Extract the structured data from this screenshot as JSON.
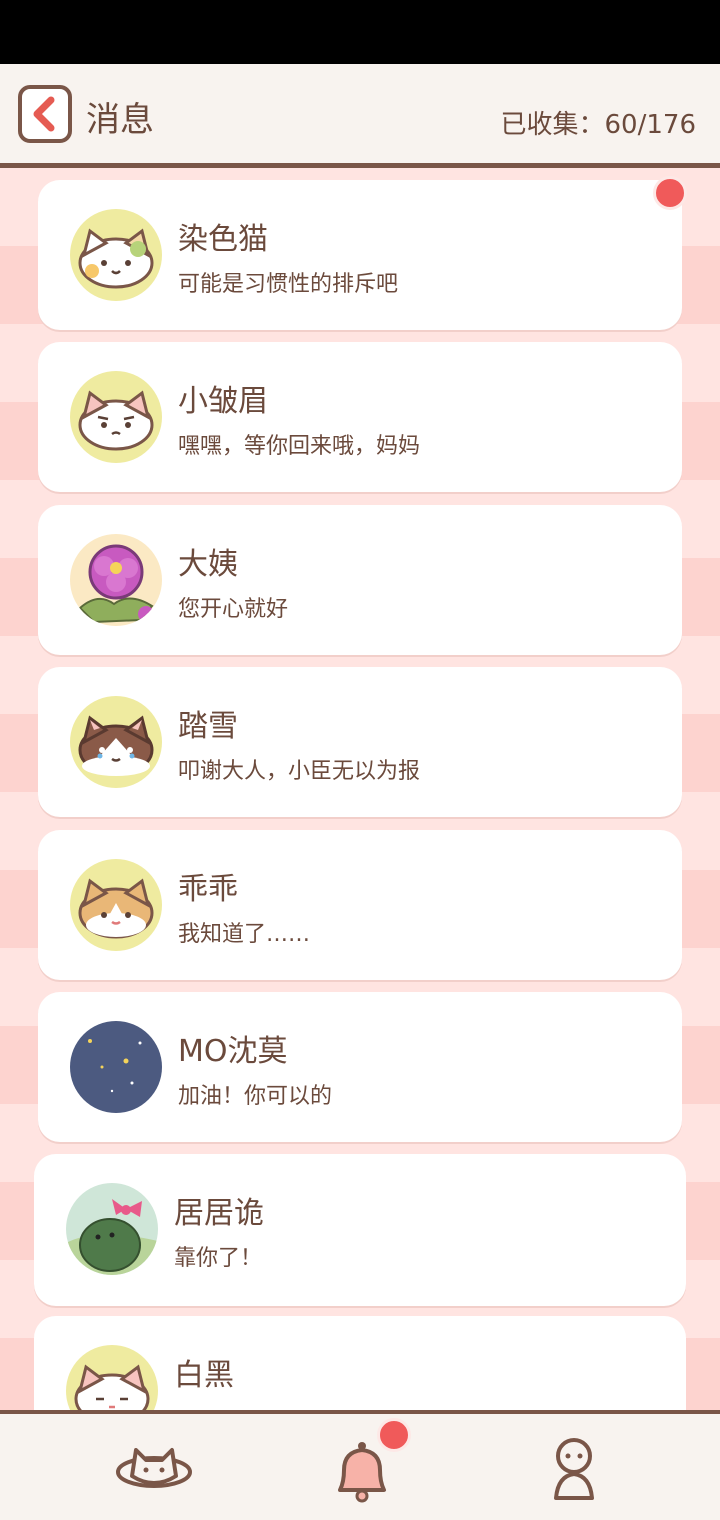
{
  "header": {
    "title": "消息",
    "collected_label": "已收集：60/176"
  },
  "messages": [
    {
      "name": "染色猫",
      "preview": "可能是习惯性的排斥吧",
      "avatar": "calico-cat-avatar",
      "unread": true
    },
    {
      "name": "小皱眉",
      "preview": "嘿嘿，等你回来哦，妈妈",
      "avatar": "frowning-cat-avatar",
      "unread": false
    },
    {
      "name": "大姨",
      "preview": "您开心就好",
      "avatar": "peony-flower-avatar",
      "unread": false
    },
    {
      "name": "踏雪",
      "preview": "叩谢大人，小臣无以为报",
      "avatar": "brown-white-cat-avatar",
      "unread": false
    },
    {
      "name": "乖乖",
      "preview": "我知道了……",
      "avatar": "orange-cat-avatar",
      "unread": false
    },
    {
      "name": "MO沈莫",
      "preview": "加油！你可以的",
      "avatar": "night-sky-avatar",
      "unread": false
    },
    {
      "name": "居居诡",
      "preview": "靠你了！",
      "avatar": "green-dino-avatar",
      "unread": false
    },
    {
      "name": "白黑",
      "preview": "",
      "avatar": "white-cat-avatar",
      "unread": false
    }
  ],
  "nav": {
    "items": [
      {
        "icon": "cat-planet-icon"
      },
      {
        "icon": "bell-icon",
        "badge": true
      },
      {
        "icon": "profile-icon"
      }
    ]
  },
  "colors": {
    "accent_red": "#f05a5a",
    "brown": "#7a5648",
    "card_bg": "#ffffff",
    "stripe_light": "#ffe4e1",
    "stripe_dark": "#fdd3cf"
  }
}
